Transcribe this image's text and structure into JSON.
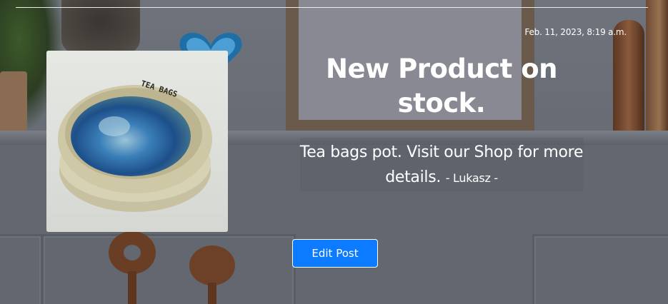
{
  "post": {
    "date": "Feb. 11, 2023, 8:19 a.m.",
    "title": "New Product on stock.",
    "excerpt": "Tea bags pot. Visit our Shop for more details.",
    "author": "- Lukasz -",
    "image": {
      "stamp_text": "TEA BAGS",
      "icon": "bowl-image"
    }
  },
  "actions": {
    "edit_label": "Edit Post"
  },
  "colors": {
    "accent": "#0d7bff",
    "text": "#ffffff"
  }
}
